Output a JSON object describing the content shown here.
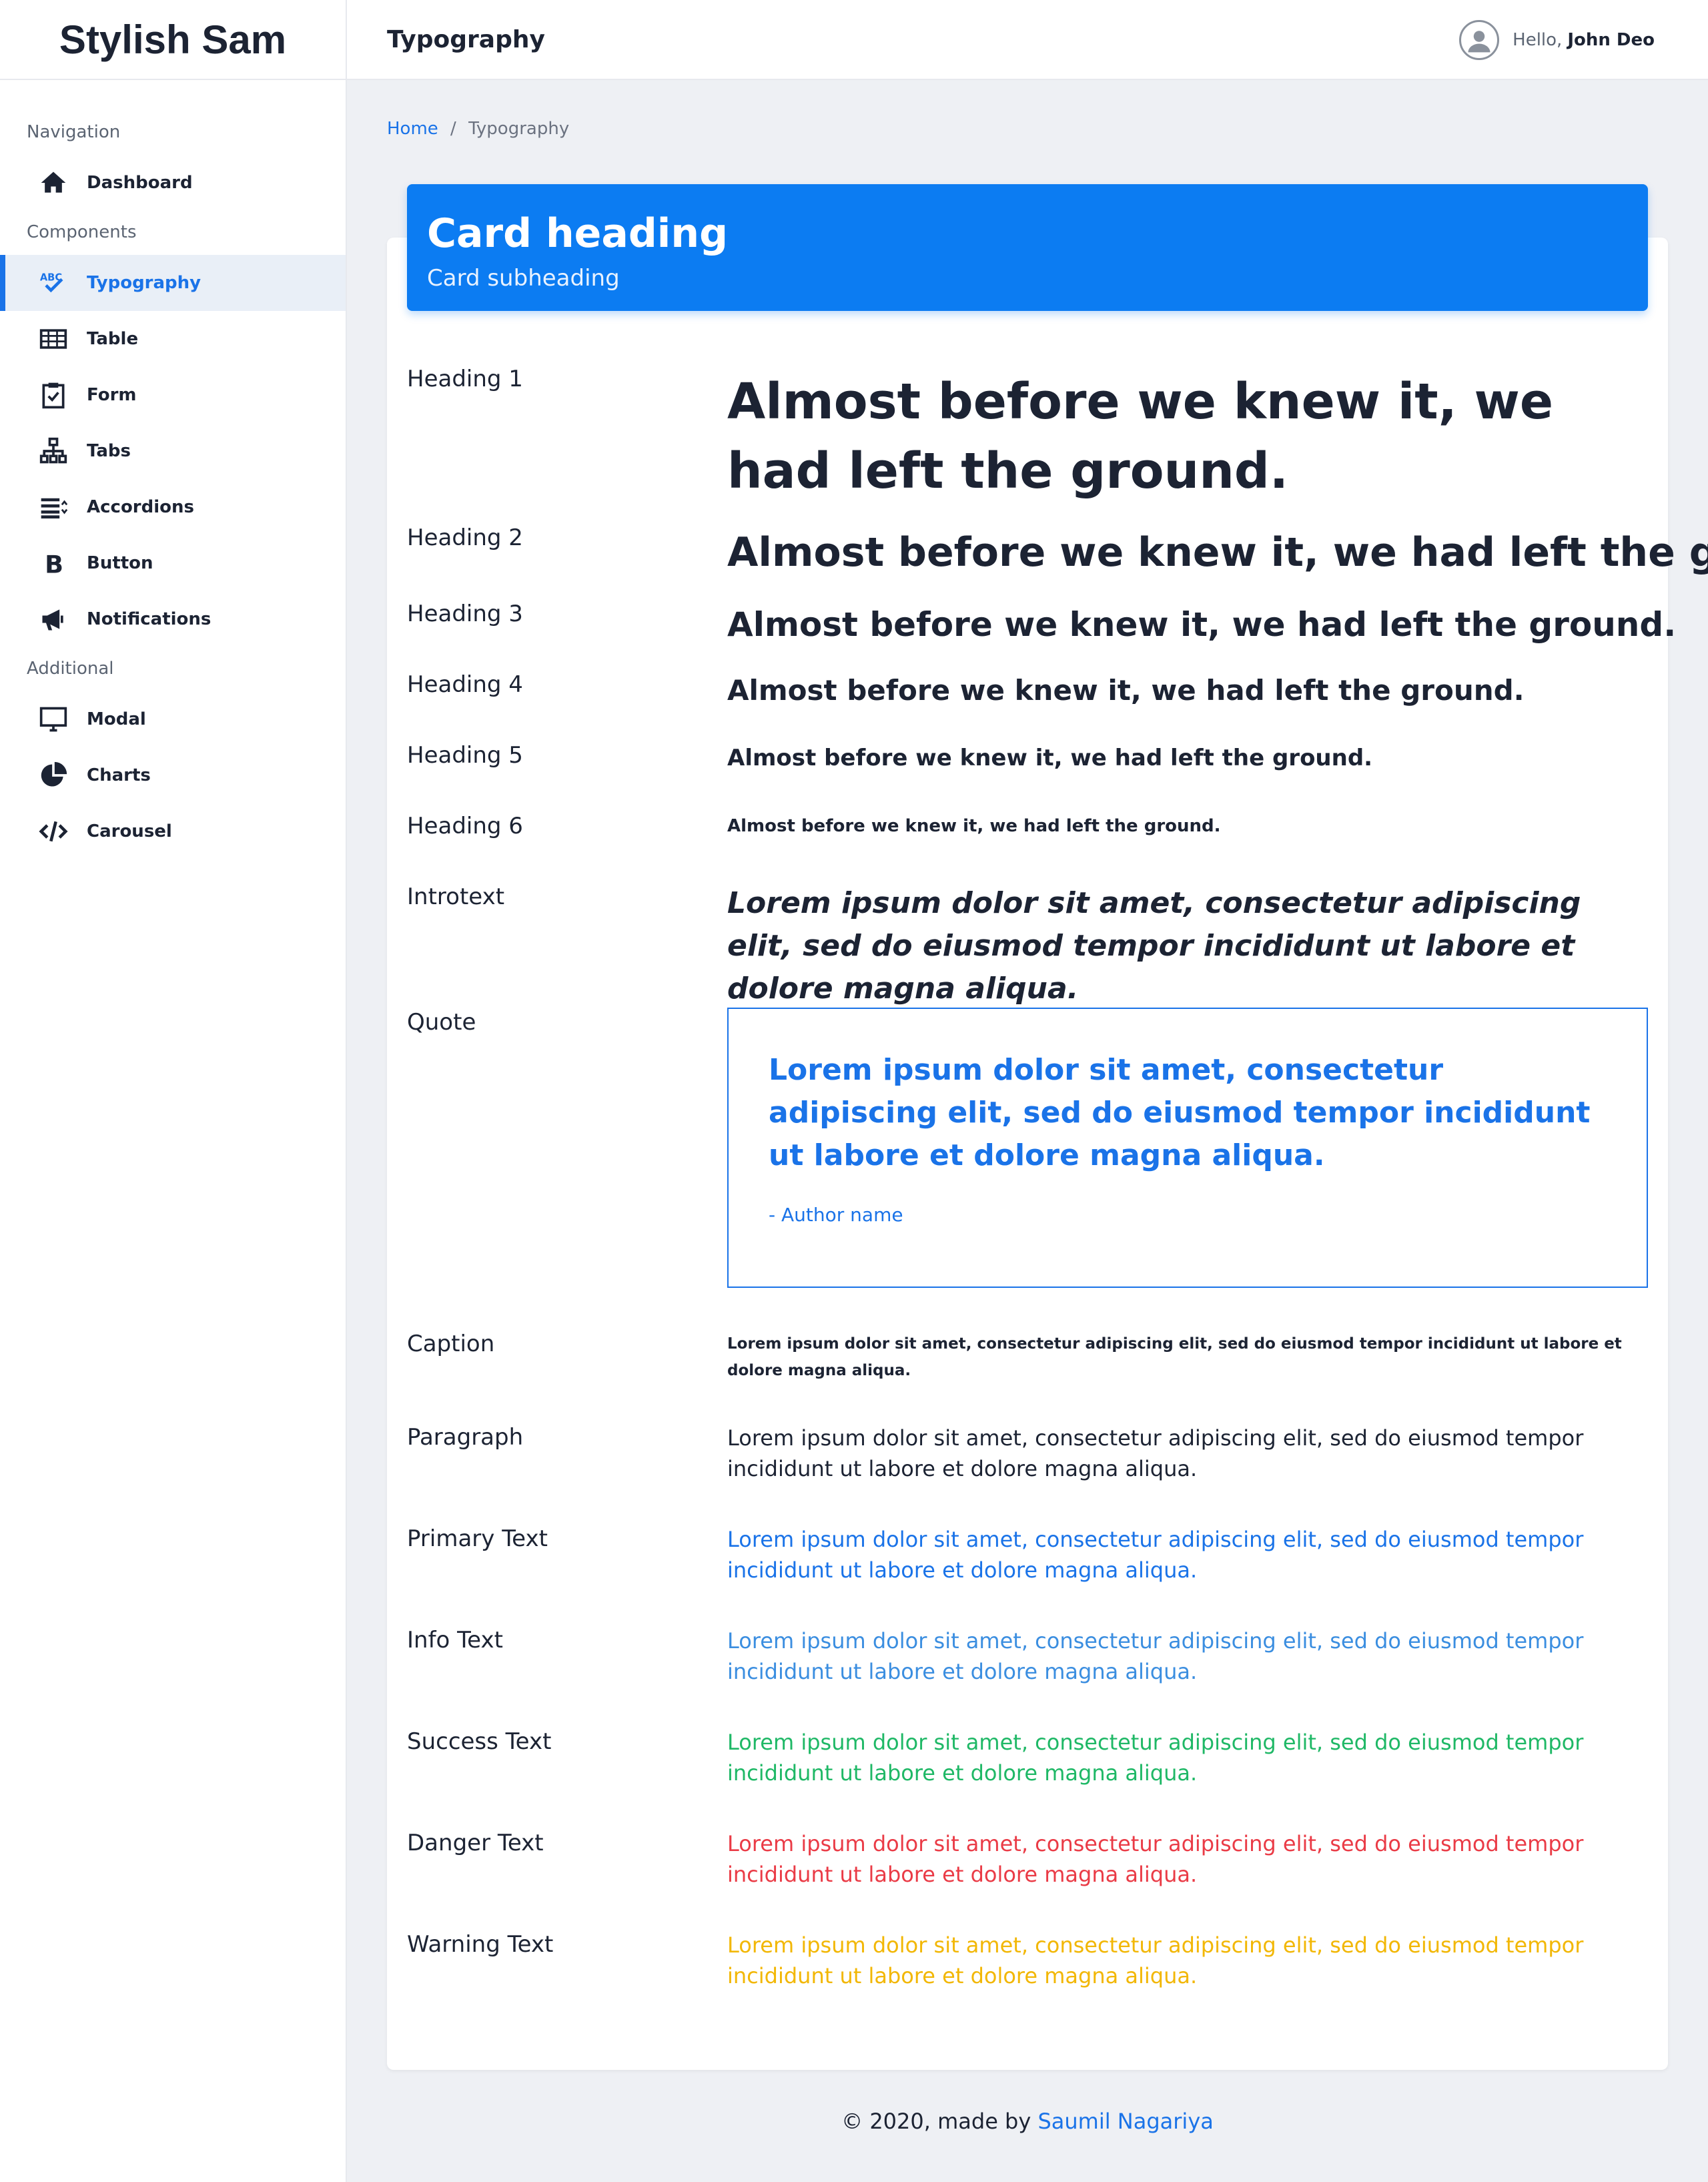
{
  "brand": "Stylish Sam",
  "topbar": {
    "title": "Typography",
    "greeting": "Hello,",
    "user_name": "John Deo"
  },
  "sidebar": {
    "sections": [
      {
        "title": "Navigation",
        "items": [
          {
            "label": "Dashboard",
            "icon": "home-icon"
          }
        ]
      },
      {
        "title": "Components",
        "items": [
          {
            "label": "Typography",
            "icon": "spellcheck-icon",
            "active": true
          },
          {
            "label": "Table",
            "icon": "table-icon"
          },
          {
            "label": "Form",
            "icon": "clipboard-check-icon"
          },
          {
            "label": "Tabs",
            "icon": "sitemap-icon"
          },
          {
            "label": "Accordions",
            "icon": "accordion-icon"
          },
          {
            "label": "Button",
            "icon": "bold-icon"
          },
          {
            "label": "Notifications",
            "icon": "megaphone-icon"
          }
        ]
      },
      {
        "title": "Additional",
        "items": [
          {
            "label": "Modal",
            "icon": "monitor-icon"
          },
          {
            "label": "Charts",
            "icon": "pie-chart-icon"
          },
          {
            "label": "Carousel",
            "icon": "code-icon"
          }
        ]
      }
    ]
  },
  "breadcrumb": {
    "home": "Home",
    "separator": "/",
    "current": "Typography"
  },
  "card": {
    "heading": "Card heading",
    "subheading": "Card subheading"
  },
  "rows": {
    "h1": {
      "label": "Heading 1",
      "text": "Almost before we knew it, we had left the ground."
    },
    "h2": {
      "label": "Heading 2",
      "text": "Almost before we knew it, we had left the ground."
    },
    "h3": {
      "label": "Heading 3",
      "text": "Almost before we knew it, we had left the ground."
    },
    "h4": {
      "label": "Heading 4",
      "text": "Almost before we knew it, we had left the ground."
    },
    "h5": {
      "label": "Heading 5",
      "text": "Almost before we knew it, we had left the ground."
    },
    "h6": {
      "label": "Heading 6",
      "text": "Almost before we knew it, we had left the ground."
    },
    "intro": {
      "label": "Introtext",
      "text": "Lorem ipsum dolor sit amet, consectetur adipiscing elit, sed do eiusmod tempor incididunt ut labore et dolore magna aliqua."
    },
    "quote": {
      "label": "Quote",
      "text": "Lorem ipsum dolor sit amet, consectetur adipiscing elit, sed do eiusmod tempor incididunt ut labore et dolore magna aliqua.",
      "author": "- Author name"
    },
    "caption": {
      "label": "Caption",
      "text": "Lorem ipsum dolor sit amet, consectetur adipiscing elit, sed do eiusmod tempor incididunt ut labore et dolore magna aliqua."
    },
    "paragraph": {
      "label": "Paragraph",
      "text": "Lorem ipsum dolor sit amet, consectetur adipiscing elit, sed do eiusmod tempor incididunt ut labore et dolore magna aliqua."
    },
    "primary": {
      "label": "Primary Text",
      "text": "Lorem ipsum dolor sit amet, consectetur adipiscing elit, sed do eiusmod tempor incididunt ut labore et dolore magna aliqua."
    },
    "info": {
      "label": "Info Text",
      "text": "Lorem ipsum dolor sit amet, consectetur adipiscing elit, sed do eiusmod tempor incididunt ut labore et dolore magna aliqua."
    },
    "success": {
      "label": "Success Text",
      "text": "Lorem ipsum dolor sit amet, consectetur adipiscing elit, sed do eiusmod tempor incididunt ut labore et dolore magna aliqua."
    },
    "danger": {
      "label": "Danger Text",
      "text": "Lorem ipsum dolor sit amet, consectetur adipiscing elit, sed do eiusmod tempor incididunt ut labore et dolore magna aliqua."
    },
    "warning": {
      "label": "Warning Text",
      "text": "Lorem ipsum dolor sit amet, consectetur adipiscing elit, sed do eiusmod tempor incididunt ut labore et dolore magna aliqua."
    }
  },
  "colors": {
    "primary": "#1a73e8",
    "info": "#3b8ee0",
    "success": "#1fb866",
    "danger": "#ea3b46",
    "warning": "#f2b705"
  },
  "footer": {
    "text": "© 2020, made by",
    "link": "Saumil Nagariya"
  }
}
